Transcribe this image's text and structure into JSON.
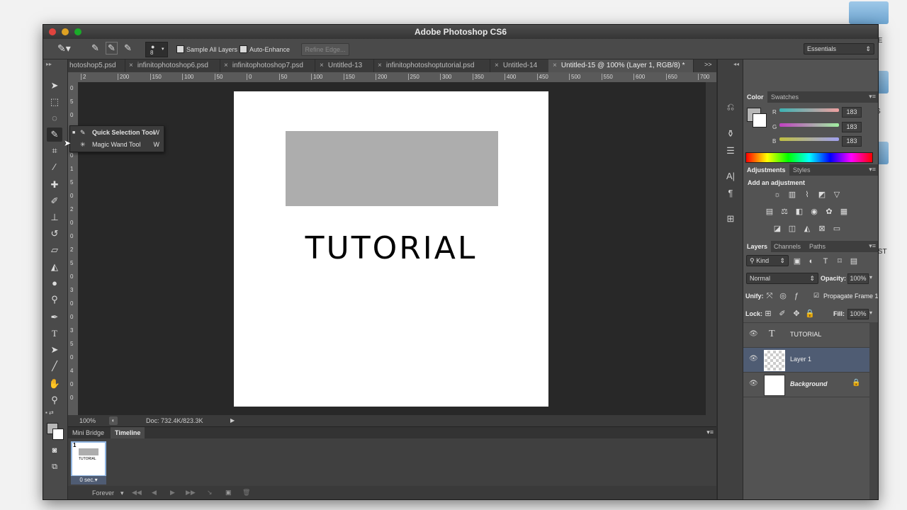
{
  "app": {
    "title": "Adobe Photoshop CS6"
  },
  "desktop": {
    "label_top": "IE",
    "label_mid": "S",
    "label_bottom": "IST"
  },
  "options": {
    "brush_size": "8",
    "sample_all_layers": "Sample All Layers",
    "auto_enhance": "Auto-Enhance",
    "refine_edge": "Refine Edge...",
    "workspace": "Essentials"
  },
  "tabs": [
    {
      "label": "hotoshop5.psd"
    },
    {
      "label": "infinitophotoshop6.psd"
    },
    {
      "label": "infinitophotoshop7.psd"
    },
    {
      "label": "Untitled-13"
    },
    {
      "label": "infinitophotoshoptutorial.psd"
    },
    {
      "label": "Untitled-14"
    },
    {
      "label": "Untitled-15 @ 100% (Layer 1, RGB/8) *"
    }
  ],
  "tabs_overflow": ">>",
  "ruler_h": [
    "2",
    "200",
    "150",
    "100",
    "50",
    "0",
    "50",
    "100",
    "150",
    "200",
    "250",
    "300",
    "350",
    "400",
    "450",
    "500",
    "550",
    "600",
    "650",
    "700"
  ],
  "ruler_v": [
    "0",
    "5",
    "0",
    "1",
    "0",
    "0",
    "1",
    "5",
    "0",
    "2",
    "0",
    "0",
    "2",
    "5",
    "0",
    "3",
    "0",
    "0",
    "3",
    "5",
    "0",
    "4",
    "0",
    "0"
  ],
  "document": {
    "text": "TUTORIAL"
  },
  "status": {
    "zoom": "100%",
    "doc": "Doc: 732.4K/823.3K"
  },
  "tool_popup": {
    "items": [
      {
        "label": "Quick Selection Tool",
        "shortcut": "W"
      },
      {
        "label": "Magic Wand Tool",
        "shortcut": "W"
      }
    ]
  },
  "bottom_panel": {
    "tabs": [
      "Mini Bridge",
      "Timeline"
    ],
    "frame_number": "1",
    "frame_text": "TUTORIAL",
    "frame_delay": "0 sec.▾",
    "loop": "Forever"
  },
  "color_panel": {
    "tabs": [
      "Color",
      "Swatches"
    ],
    "r_label": "R",
    "g_label": "G",
    "b_label": "B",
    "r": "183",
    "g": "183",
    "b": "183"
  },
  "adjustments_panel": {
    "tabs": [
      "Adjustments",
      "Styles"
    ],
    "heading": "Add an adjustment"
  },
  "layers_panel": {
    "tabs": [
      "Layers",
      "Channels",
      "Paths"
    ],
    "kind": "Kind",
    "blend_mode": "Normal",
    "opacity_label": "Opacity:",
    "opacity": "100%",
    "unify_label": "Unify:",
    "propagate": "Propagate Frame 1",
    "lock_label": "Lock:",
    "fill_label": "Fill:",
    "fill": "100%",
    "layers": [
      {
        "name": "TUTORIAL"
      },
      {
        "name": "Layer 1"
      },
      {
        "name": "Background"
      }
    ]
  },
  "colors": {
    "window_bg": "#2e2e2e",
    "panel_bg": "#535353",
    "selected_layer": "#4f5c73",
    "doc_gray": "#adadad"
  }
}
